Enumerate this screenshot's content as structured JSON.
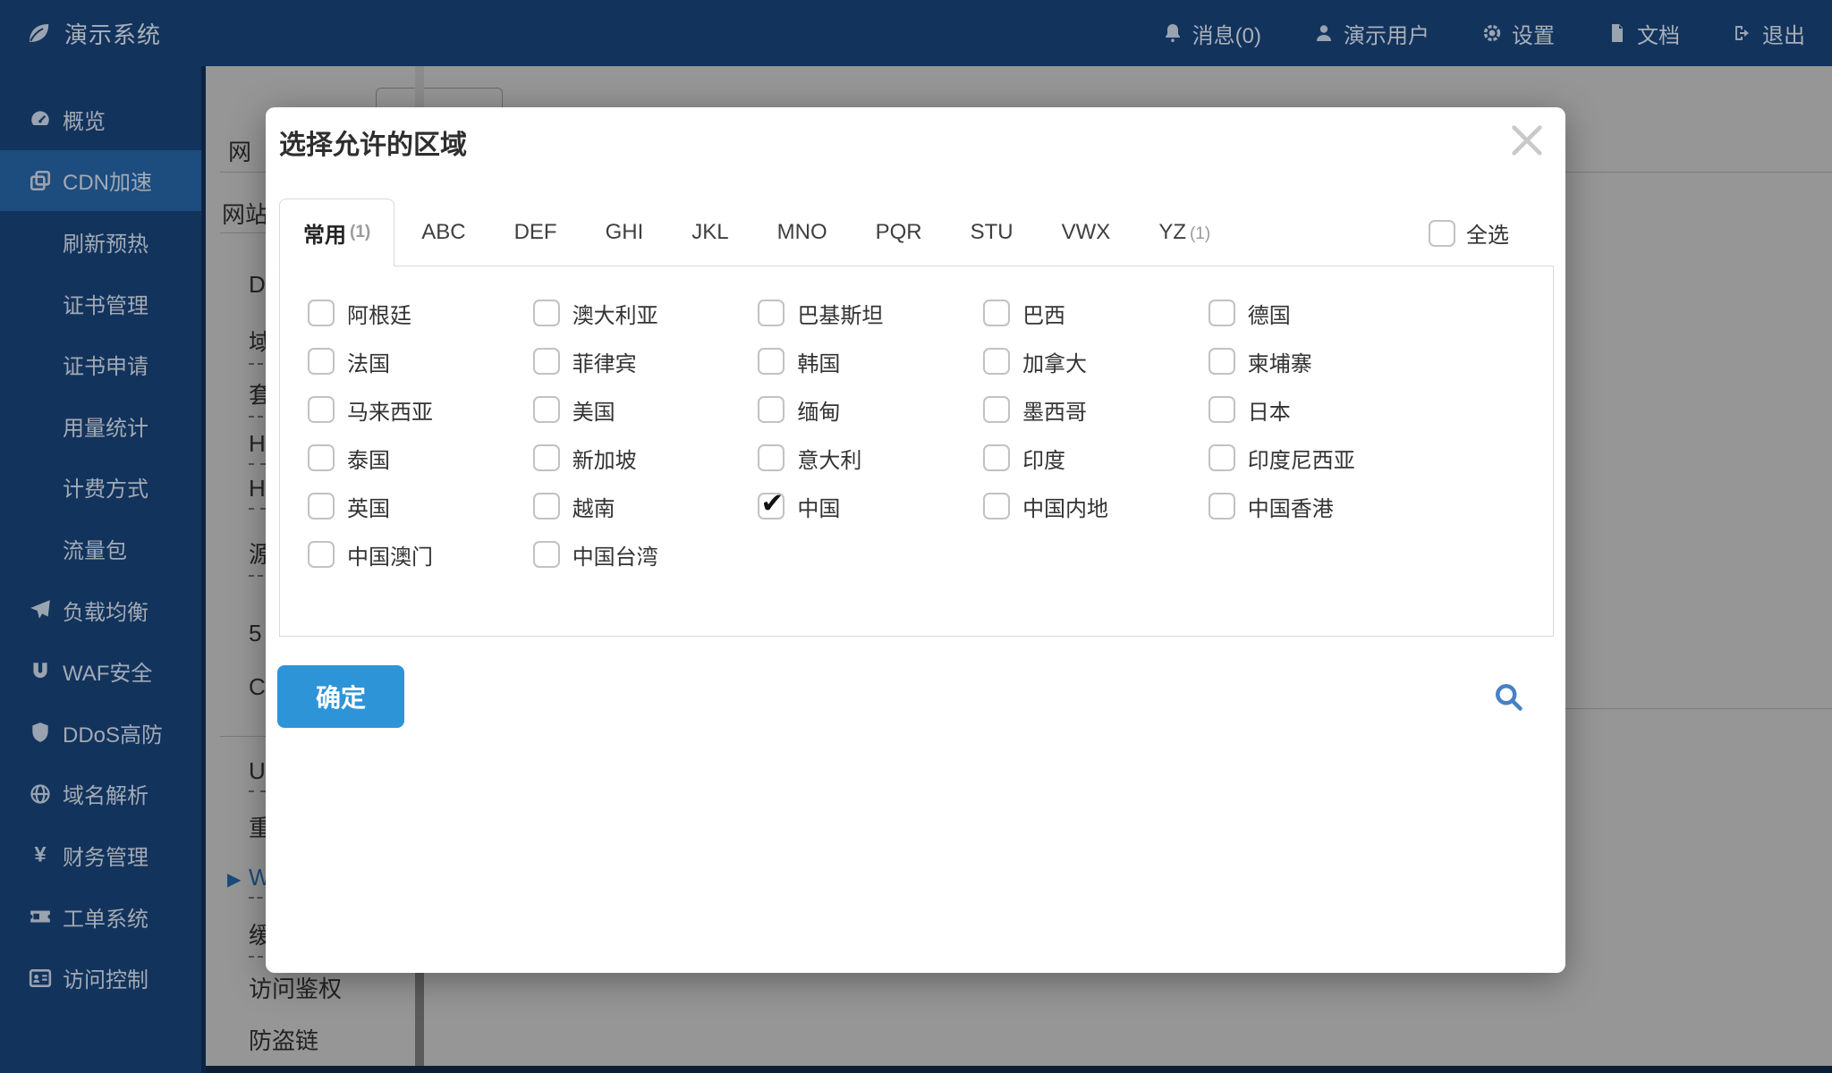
{
  "topbar": {
    "logo": {
      "icon_name": "leaf-icon",
      "icon": "#i-leaf",
      "title": "演示系统"
    },
    "items": [
      {
        "label": "消息(0)",
        "icon": "#i-bell",
        "icon_name": "bell-icon"
      },
      {
        "label": "演示用户",
        "icon": "#i-user",
        "icon_name": "user-icon"
      },
      {
        "label": "设置",
        "icon": "#i-gear",
        "icon_name": "gear-icon"
      },
      {
        "label": "文档",
        "icon": "#i-doc",
        "icon_name": "document-icon"
      },
      {
        "label": "退出",
        "icon": "#i-logout",
        "icon_name": "logout-icon"
      }
    ]
  },
  "sidebar": {
    "items": [
      {
        "label": "概览",
        "icon": "#i-gauge",
        "icon_name": "gauge-icon"
      },
      {
        "label": "CDN加速",
        "icon": "#i-cdn",
        "icon_name": "copy-squares-icon",
        "active": true
      },
      {
        "label": "刷新预热"
      },
      {
        "label": "证书管理"
      },
      {
        "label": "证书申请"
      },
      {
        "label": "用量统计"
      },
      {
        "label": "计费方式"
      },
      {
        "label": "流量包"
      },
      {
        "label": "负载均衡",
        "icon": "#i-plane",
        "icon_name": "paper-plane-icon"
      },
      {
        "label": "WAF安全",
        "icon": "#i-magnet",
        "icon_name": "magnet-icon"
      },
      {
        "label": "DDoS高防",
        "icon": "#i-shield",
        "icon_name": "shield-icon"
      },
      {
        "label": "域名解析",
        "icon": "#i-globe",
        "icon_name": "globe-icon"
      },
      {
        "label": "财务管理",
        "icon": "#i-yen",
        "icon_name": "yen-icon"
      },
      {
        "label": "工单系统",
        "icon": "#i-ticket",
        "icon_name": "ticket-icon"
      },
      {
        "label": "访问控制",
        "icon": "#i-idcard",
        "icon_name": "id-card-icon"
      }
    ]
  },
  "background": {
    "items": [
      "网",
      "网站",
      "D",
      "域",
      "套",
      "H",
      "H",
      "源",
      "5",
      "C",
      "U",
      "重",
      "W",
      "缓",
      "访问鉴权",
      "防盗链"
    ],
    "link_arrow": "▶"
  },
  "modal": {
    "title": "选择允许的区域",
    "select_all_label": "全选",
    "check_glyph": "✔",
    "confirm_label": "确定",
    "tabs": [
      {
        "label": "常用",
        "count": "(1)",
        "active": true
      },
      {
        "label": "ABC"
      },
      {
        "label": "DEF"
      },
      {
        "label": "GHI"
      },
      {
        "label": "JKL"
      },
      {
        "label": "MNO"
      },
      {
        "label": "PQR"
      },
      {
        "label": "STU"
      },
      {
        "label": "VWX"
      },
      {
        "label": "YZ",
        "count": "(1)"
      }
    ],
    "regions": [
      {
        "label": "阿根廷"
      },
      {
        "label": "澳大利亚"
      },
      {
        "label": "巴基斯坦"
      },
      {
        "label": "巴西"
      },
      {
        "label": "德国"
      },
      {
        "label": "法国"
      },
      {
        "label": "菲律宾"
      },
      {
        "label": "韩国"
      },
      {
        "label": "加拿大"
      },
      {
        "label": "柬埔寨"
      },
      {
        "label": "马来西亚"
      },
      {
        "label": "美国"
      },
      {
        "label": "缅甸"
      },
      {
        "label": "墨西哥"
      },
      {
        "label": "日本"
      },
      {
        "label": "泰国"
      },
      {
        "label": "新加坡"
      },
      {
        "label": "意大利"
      },
      {
        "label": "印度"
      },
      {
        "label": "印度尼西亚"
      },
      {
        "label": "英国"
      },
      {
        "label": "越南"
      },
      {
        "label": "中国",
        "checked": true
      },
      {
        "label": "中国内地"
      },
      {
        "label": "中国香港"
      },
      {
        "label": "中国澳门"
      },
      {
        "label": "中国台湾"
      }
    ],
    "colors": {
      "navy": "#12335c",
      "sidebar_active": "#1d4c7e",
      "confirm_blue": "#2d94d8",
      "search_blue": "#4681c4",
      "link_blue": "#2f7fd1"
    }
  }
}
